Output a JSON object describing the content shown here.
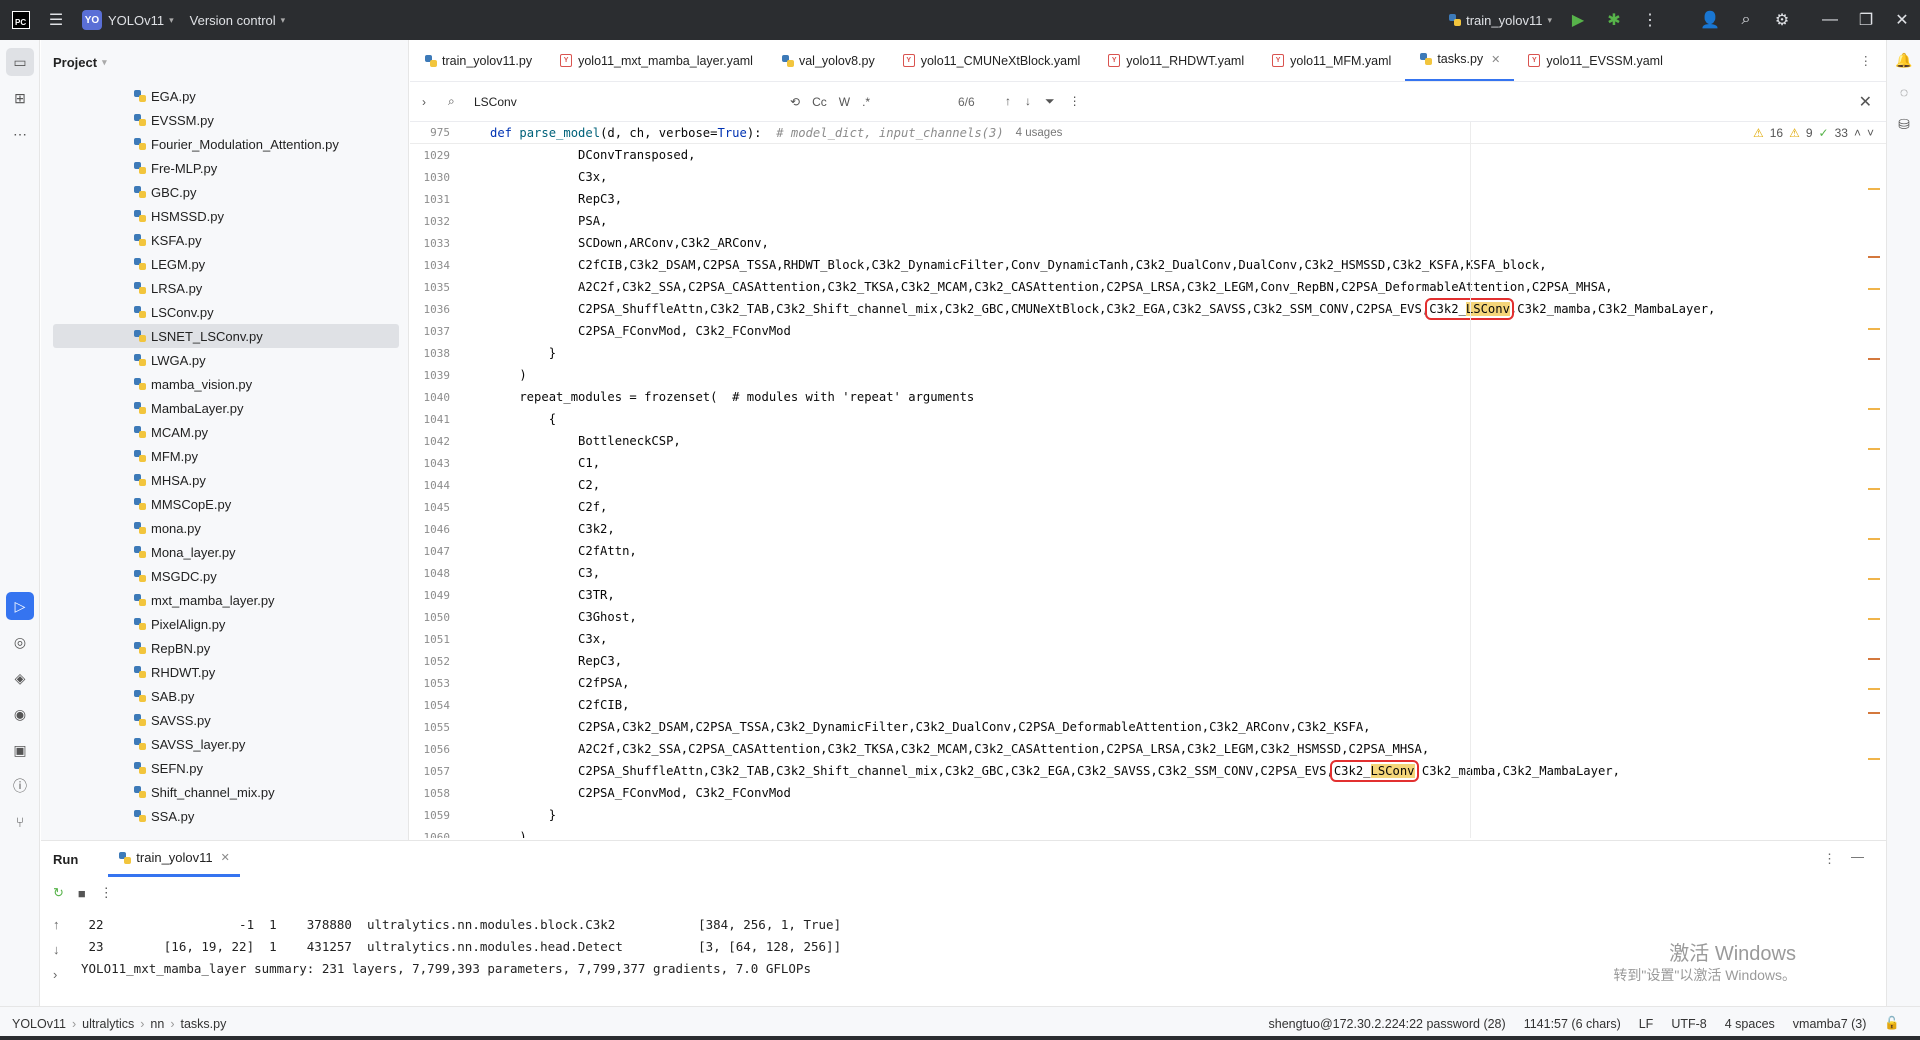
{
  "titlebar": {
    "app_badge": "PC",
    "project_badge": "YO",
    "project_name": "YOLOv11",
    "vcs": "Version control",
    "run_config": "train_yolov11"
  },
  "project_panel": {
    "title": "Project",
    "files": [
      "EGA.py",
      "EVSSM.py",
      "Fourier_Modulation_Attention.py",
      "Fre-MLP.py",
      "GBC.py",
      "HSMSSD.py",
      "KSFA.py",
      "LEGM.py",
      "LRSA.py",
      "LSConv.py",
      "LSNET_LSConv.py",
      "LWGA.py",
      "mamba_vision.py",
      "MambaLayer.py",
      "MCAM.py",
      "MFM.py",
      "MHSA.py",
      "MMSCopE.py",
      "mona.py",
      "Mona_layer.py",
      "MSGDC.py",
      "mxt_mamba_layer.py",
      "PixelAlign.py",
      "RepBN.py",
      "RHDWT.py",
      "SAB.py",
      "SAVSS.py",
      "SAVSS_layer.py",
      "SEFN.py",
      "Shift_channel_mix.py",
      "SSA.py"
    ],
    "selected": "LSNET_LSConv.py"
  },
  "tabs": [
    {
      "label": "train_yolov11.py",
      "type": "py"
    },
    {
      "label": "yolo11_mxt_mamba_layer.yaml",
      "type": "yaml"
    },
    {
      "label": "val_yolov8.py",
      "type": "py"
    },
    {
      "label": "yolo11_CMUNeXtBlock.yaml",
      "type": "yaml"
    },
    {
      "label": "yolo11_RHDWT.yaml",
      "type": "yaml"
    },
    {
      "label": "yolo11_MFM.yaml",
      "type": "yaml"
    },
    {
      "label": "tasks.py",
      "type": "py",
      "active": true
    },
    {
      "label": "yolo11_EVSSM.yaml",
      "type": "yaml"
    }
  ],
  "find": {
    "query": "LSConv",
    "cc": "Cc",
    "w": "W",
    "regex": ".*",
    "count": "6/6"
  },
  "editor": {
    "header_line_no": "975",
    "header_def": "def ",
    "header_fn": "parse_model",
    "header_args": "(d, ch, verbose=",
    "header_true": "True",
    "header_close": "):  ",
    "header_comment": "# model_dict, input_channels(3)",
    "header_usages": "4 usages",
    "warn_count": "16",
    "weak_count": "9",
    "ok_count": "33",
    "lines": [
      {
        "n": "1029",
        "t": "            DConvTransposed,"
      },
      {
        "n": "1030",
        "t": "            C3x,"
      },
      {
        "n": "1031",
        "t": "            RepC3,"
      },
      {
        "n": "1032",
        "t": "            PSA,"
      },
      {
        "n": "1033",
        "t": "            SCDown,ARConv,C3k2_ARConv,"
      },
      {
        "n": "1034",
        "t": "            C2fCIB,C3k2_DSAM,C2PSA_TSSA,RHDWT_Block,C3k2_DynamicFilter,Conv_DynamicTanh,C3k2_DualConv,DualConv,C3k2_HSMSSD,C3k2_KSFA,KSFA_block,"
      },
      {
        "n": "1035",
        "t": "            A2C2f,C3k2_SSA,C2PSA_CASAttention,C3k2_TKSA,C3k2_MCAM,C3k2_CASAttention,C2PSA_LRSA,C3k2_LEGM,Conv_RepBN,C2PSA_DeformableAttention,C2PSA_MHSA,"
      },
      {
        "n": "1036",
        "pre": "            C2PSA_ShuffleAttn,C3k2_TAB,C3k2_Shift_channel_mix,C3k2_GBC,CMUNeXtBlock,C3k2_EGA,C3k2_SAVSS,C3k2_SSM_CONV,C2PSA_EVS,",
        "mid1": "C3k2_",
        "hit": "LSConv",
        "post": ",C3k2_mamba,C3k2_MambaLayer,"
      },
      {
        "n": "1037",
        "t": "            C2PSA_FConvMod, C3k2_FConvMod"
      },
      {
        "n": "1038",
        "t": "        }"
      },
      {
        "n": "1039",
        "t": "    )"
      },
      {
        "n": "1040",
        "t": "    repeat_modules = frozenset(  # modules with 'repeat' arguments"
      },
      {
        "n": "1041",
        "t": "        {"
      },
      {
        "n": "1042",
        "t": "            BottleneckCSP,"
      },
      {
        "n": "1043",
        "t": "            C1,"
      },
      {
        "n": "1044",
        "t": "            C2,"
      },
      {
        "n": "1045",
        "t": "            C2f,"
      },
      {
        "n": "1046",
        "t": "            C3k2,"
      },
      {
        "n": "1047",
        "t": "            C2fAttn,"
      },
      {
        "n": "1048",
        "t": "            C3,"
      },
      {
        "n": "1049",
        "t": "            C3TR,"
      },
      {
        "n": "1050",
        "t": "            C3Ghost,"
      },
      {
        "n": "1051",
        "t": "            C3x,"
      },
      {
        "n": "1052",
        "t": "            RepC3,"
      },
      {
        "n": "1053",
        "t": "            C2fPSA,"
      },
      {
        "n": "1054",
        "t": "            C2fCIB,"
      },
      {
        "n": "1055",
        "t": "            C2PSA,C3k2_DSAM,C2PSA_TSSA,C3k2_DynamicFilter,C3k2_DualConv,C2PSA_DeformableAttention,C3k2_ARConv,C3k2_KSFA,"
      },
      {
        "n": "1056",
        "t": "            A2C2f,C3k2_SSA,C2PSA_CASAttention,C3k2_TKSA,C3k2_MCAM,C3k2_CASAttention,C2PSA_LRSA,C3k2_LEGM,C3k2_HSMSSD,C2PSA_MHSA,"
      },
      {
        "n": "1057",
        "pre": "            C2PSA_ShuffleAttn,C3k2_TAB,C3k2_Shift_channel_mix,C3k2_GBC,C3k2_EGA,C3k2_SAVSS,C3k2_SSM_CONV,C2PSA_EVS,",
        "mid1": "C3k2_",
        "hit": "LSConv",
        "post": ",C3k2_mamba,C3k2_MambaLayer,"
      },
      {
        "n": "1058",
        "t": "            C2PSA_FConvMod, C3k2_FConvMod"
      },
      {
        "n": "1059",
        "t": "        }"
      },
      {
        "n": "1060",
        "t": "    )"
      }
    ]
  },
  "run_panel": {
    "title": "Run",
    "tab": "train_yolov11",
    "console": [
      " 22                  -1  1    378880  ultralytics.nn.modules.block.C3k2           [384, 256, 1, True]",
      " 23        [16, 19, 22]  1    431257  ultralytics.nn.modules.head.Detect          [3, [64, 128, 256]]",
      "YOLO11_mxt_mamba_layer summary: 231 layers, 7,799,393 parameters, 7,799,377 gradients, 7.0 GFLOPs"
    ],
    "watermark_title": "激活 Windows",
    "watermark_sub": "转到\"设置\"以激活 Windows。"
  },
  "statusbar": {
    "crumbs": [
      "YOLOv11",
      "ultralytics",
      "nn",
      "tasks.py"
    ],
    "remote": "shengtuo@172.30.2.224:22 password (28)",
    "position": "1141:57 (6 chars)",
    "line_sep": "LF",
    "encoding": "UTF-8",
    "indent": "4 spaces",
    "interpreter": "vmamba7 (3)"
  }
}
